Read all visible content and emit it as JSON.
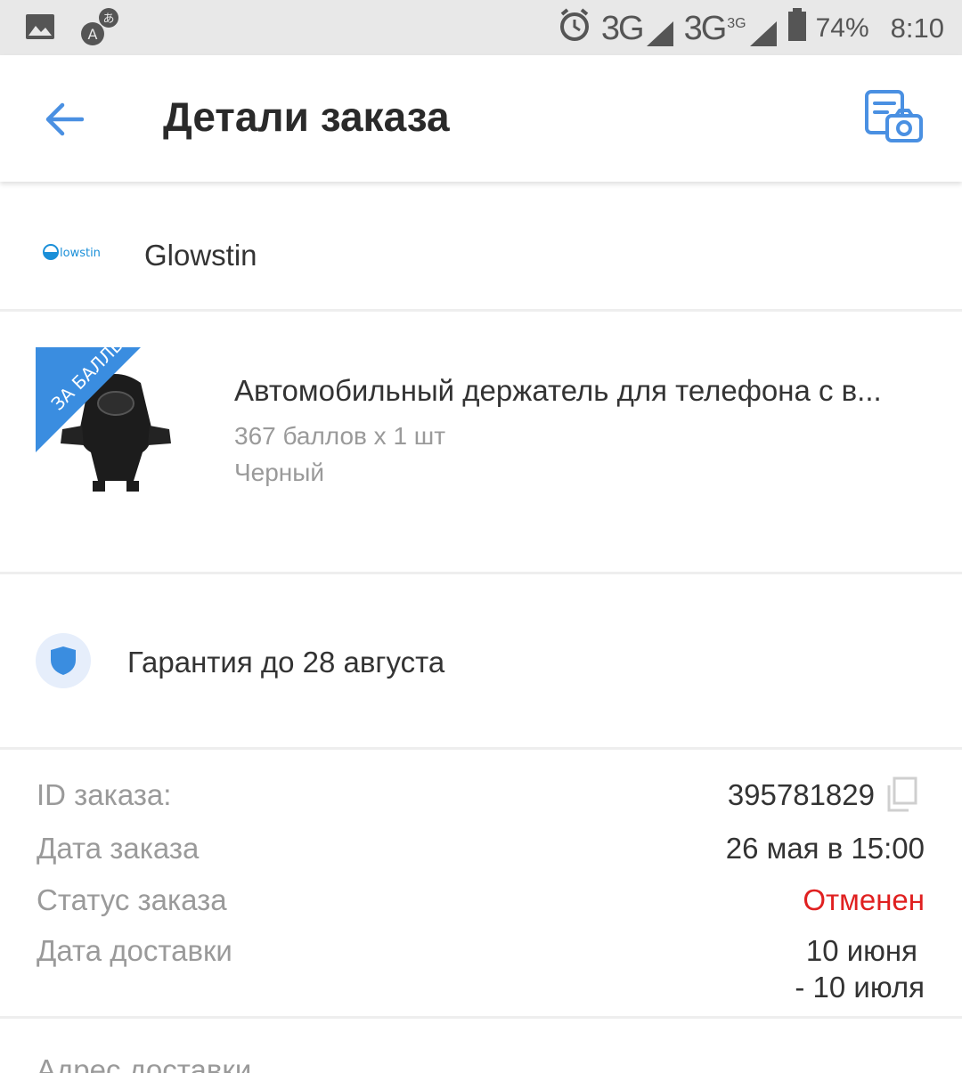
{
  "status_bar": {
    "network_1": "3G",
    "network_2": "3G",
    "network_2_sup": "3G",
    "battery": "74%",
    "time": "8:10"
  },
  "header": {
    "title": "Детали заказа",
    "back_icon": "arrow-left-icon",
    "photo_icon": "photo-gallery-camera-icon"
  },
  "store": {
    "logo_text": "lowstin",
    "name": "Glowstin"
  },
  "product": {
    "badge": "ЗА БАЛЛЫ",
    "title": "Автомобильный держатель для телефона с в...",
    "price_line": "367 баллов x 1 шт",
    "color": "Черный"
  },
  "warranty": {
    "text": "Гарантия до 28 августа"
  },
  "order": {
    "id_label": "ID заказа:",
    "id_value": "395781829",
    "date_label": "Дата заказа",
    "date_value": "26 мая в 15:00",
    "status_label": "Статус заказа",
    "status_value": "Отменен",
    "delivery_label": "Дата доставки",
    "delivery_value_1": "10 июня",
    "delivery_value_2": "- 10 июля"
  },
  "address": {
    "label": "Адрес доставки"
  },
  "colors": {
    "accent": "#4a90e2",
    "status_cancelled": "#e02020"
  }
}
